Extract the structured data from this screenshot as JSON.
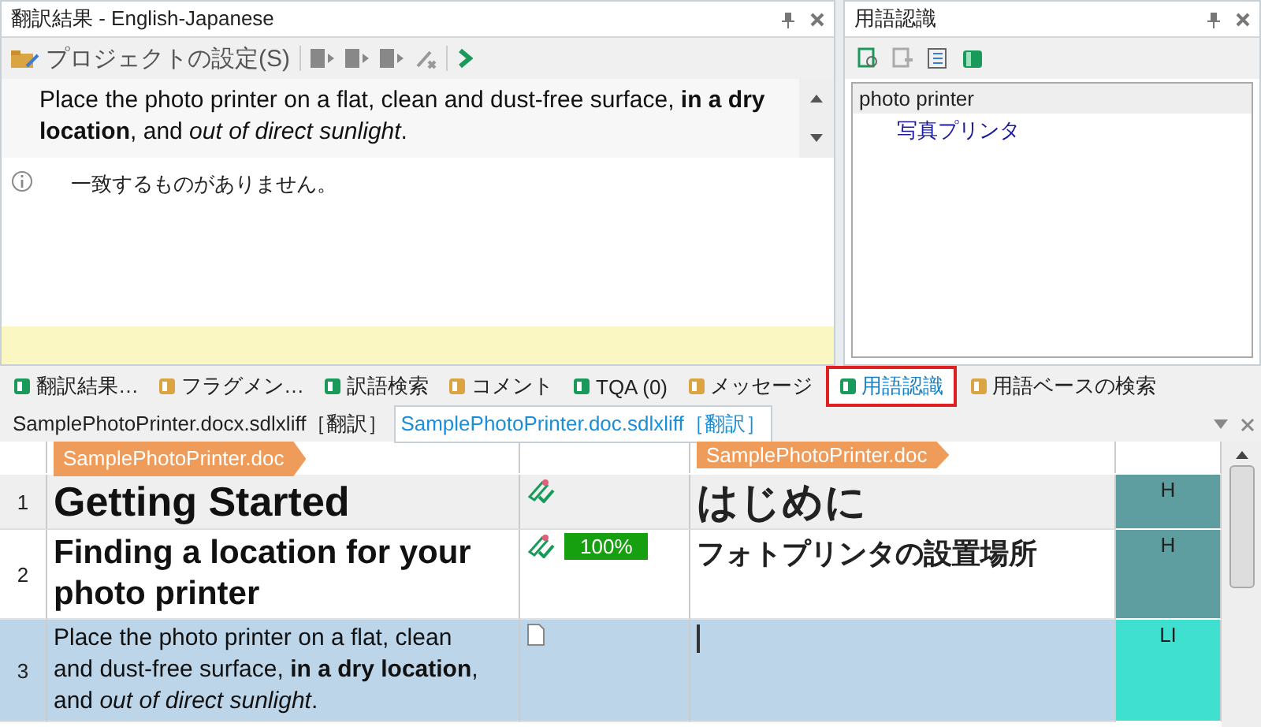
{
  "translation_results": {
    "title": "翻訳結果 - English-Japanese",
    "project_settings": "プロジェクトの設定(S)",
    "source_text": "Place the photo printer on a flat, clean and dust-free surface, **in a dry location**, and *out of direct sunlight*.",
    "message": "一致するものがありません。"
  },
  "term_recognition": {
    "title": "用語認識",
    "terms": [
      {
        "source": "photo printer",
        "target": "写真プリンタ"
      }
    ]
  },
  "bottom_tabs": [
    {
      "label": "翻訳結果…",
      "selected": false
    },
    {
      "label": "フラグメン…",
      "selected": false
    },
    {
      "label": "訳語検索",
      "selected": false
    },
    {
      "label": "コメント",
      "selected": false
    },
    {
      "label": "TQA (0)",
      "selected": false
    },
    {
      "label": "メッセージ",
      "selected": false
    },
    {
      "label": "用語認識",
      "selected": true
    },
    {
      "label": "用語ベースの検索",
      "selected": false
    }
  ],
  "document_tabs": [
    {
      "label": "SamplePhotoPrinter.docx.sdlxliff［翻訳］",
      "selected": false
    },
    {
      "label": "SamplePhotoPrinter.doc.sdlxliff［翻訳］",
      "selected": true
    }
  ],
  "editor": {
    "source_file": "SamplePhotoPrinter.doc",
    "target_file": "SamplePhotoPrinter.doc",
    "segments": [
      {
        "number": "1",
        "kind": "heading1",
        "source": "Getting Started",
        "target": "はじめに",
        "translated": true,
        "style": "H",
        "color": "#5f9ea0",
        "selected": false
      },
      {
        "number": "2",
        "kind": "heading2",
        "source": "Finding a location for your photo printer",
        "target": "フォトプリンタの設置場所",
        "translated": true,
        "match": "100%",
        "style": "H",
        "color": "#5f9ea0",
        "selected": false
      },
      {
        "number": "3",
        "kind": "body",
        "source": "Place the photo printer on a flat, clean and dust-free surface, **in a dry location**, and *out of direct sunlight*.",
        "translated": false,
        "style": "LI",
        "color": "#40e0d0",
        "selected": true
      }
    ]
  }
}
